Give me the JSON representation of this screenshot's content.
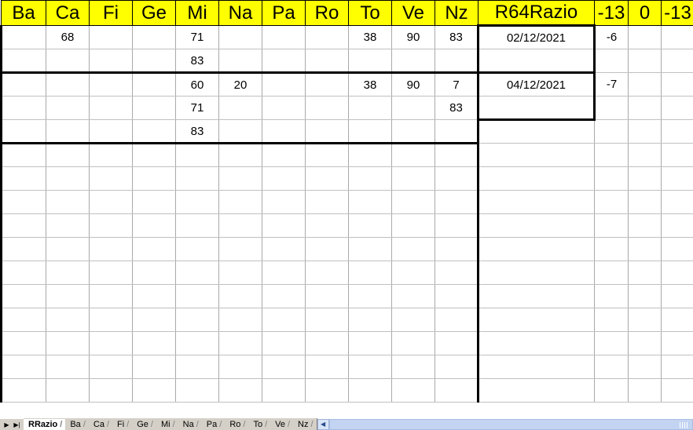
{
  "header": {
    "columns": [
      "Ba",
      "Ca",
      "Fi",
      "Ge",
      "Mi",
      "Na",
      "Pa",
      "Ro",
      "To",
      "Ve",
      "Nz"
    ],
    "title": "R64Razio",
    "trailing": [
      "-13",
      "0",
      "-13"
    ],
    "title_color": "#ff0000",
    "title_bg": "#ccffff",
    "header_bg": "#ffff00"
  },
  "rows": [
    {
      "cells": [
        "",
        "68",
        "",
        "",
        "71",
        "",
        "",
        "",
        "38",
        "90",
        "83"
      ],
      "date": "02/12/2021",
      "delta": "-6",
      "extra": [
        "",
        ""
      ]
    },
    {
      "cells": [
        "",
        "",
        "",
        "",
        "83",
        "",
        "",
        "",
        "",
        "",
        ""
      ],
      "date": "",
      "delta": "",
      "extra": [
        "",
        ""
      ]
    },
    {
      "cells": [
        "",
        "",
        "",
        "",
        "60",
        "20",
        "",
        "",
        "38",
        "90",
        "7"
      ],
      "date": "04/12/2021",
      "delta": "-7",
      "extra": [
        "",
        ""
      ]
    },
    {
      "cells": [
        "",
        "",
        "",
        "",
        "71",
        "",
        "",
        "",
        "",
        "",
        "83"
      ],
      "date": "",
      "delta": "",
      "extra": [
        "",
        ""
      ]
    },
    {
      "cells": [
        "",
        "",
        "",
        "",
        "83",
        "",
        "",
        "",
        "",
        "",
        ""
      ],
      "date": "",
      "delta": "",
      "extra": [
        "",
        ""
      ]
    }
  ],
  "empty_row_count": 11,
  "date_color": "#00008b",
  "statusbar": {
    "nav_first": "◀",
    "nav_prev": "▶",
    "nav_next": "▶|",
    "tabs": [
      {
        "label": "RRazio",
        "active": true
      },
      {
        "label": "Ba",
        "active": false
      },
      {
        "label": "Ca",
        "active": false
      },
      {
        "label": "Fi",
        "active": false
      },
      {
        "label": "Ge",
        "active": false
      },
      {
        "label": "Mi",
        "active": false
      },
      {
        "label": "Na",
        "active": false
      },
      {
        "label": "Pa",
        "active": false
      },
      {
        "label": "Ro",
        "active": false
      },
      {
        "label": "To",
        "active": false
      },
      {
        "label": "Ve",
        "active": false
      },
      {
        "label": "Nz",
        "active": false
      }
    ],
    "scroll_left_label": "◀"
  }
}
